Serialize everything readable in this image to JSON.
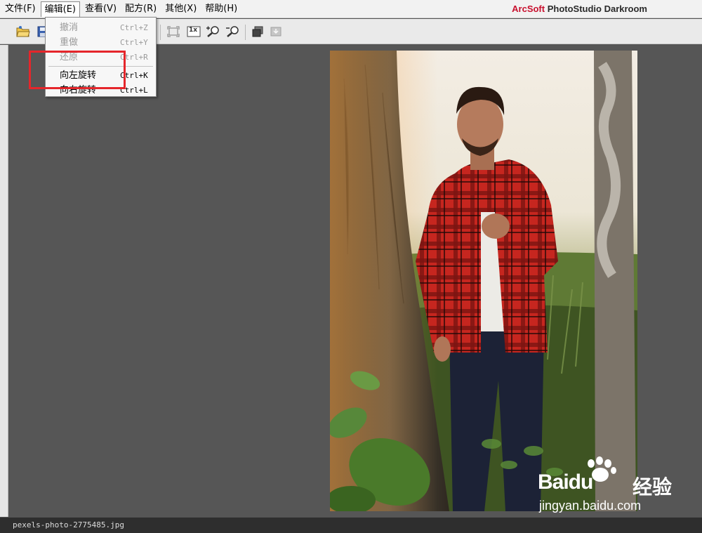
{
  "menubar": {
    "items": [
      {
        "label": "文件(F)"
      },
      {
        "label": "编辑(E)"
      },
      {
        "label": "查看(V)"
      },
      {
        "label": "配方(R)"
      },
      {
        "label": "其他(X)"
      },
      {
        "label": "帮助(H)"
      }
    ],
    "brand_prefix": "ArcSoft",
    "brand_name": "PhotoStudio Darkroom"
  },
  "edit_menu": {
    "items": [
      {
        "label": "撤消",
        "shortcut": "Ctrl+Z",
        "enabled": false
      },
      {
        "label": "重做",
        "shortcut": "Ctrl+Y",
        "enabled": false
      },
      {
        "label": "还原",
        "shortcut": "Ctrl+R",
        "enabled": false
      },
      {
        "label": "向左旋转",
        "shortcut": "Ctrl+K",
        "enabled": true
      },
      {
        "label": "向右旋转",
        "shortcut": "Ctrl+L",
        "enabled": true
      }
    ]
  },
  "toolbar": {
    "icons": [
      "open-folder-icon",
      "save-icon",
      "fit-screen-icon",
      "actual-size-icon",
      "zoom-in-icon",
      "zoom-out-icon",
      "copy-icon",
      "import-icon"
    ],
    "actual_size_label": "1x"
  },
  "statusbar": {
    "filename": "pexels-photo-2775485.jpg"
  },
  "watermark": {
    "logo": "Baidu",
    "cn": "经验",
    "url": "jingyan.baidu.com"
  },
  "colors": {
    "highlight": "#e5262b",
    "brand_accent": "#c8102e",
    "canvas": "#565656"
  }
}
